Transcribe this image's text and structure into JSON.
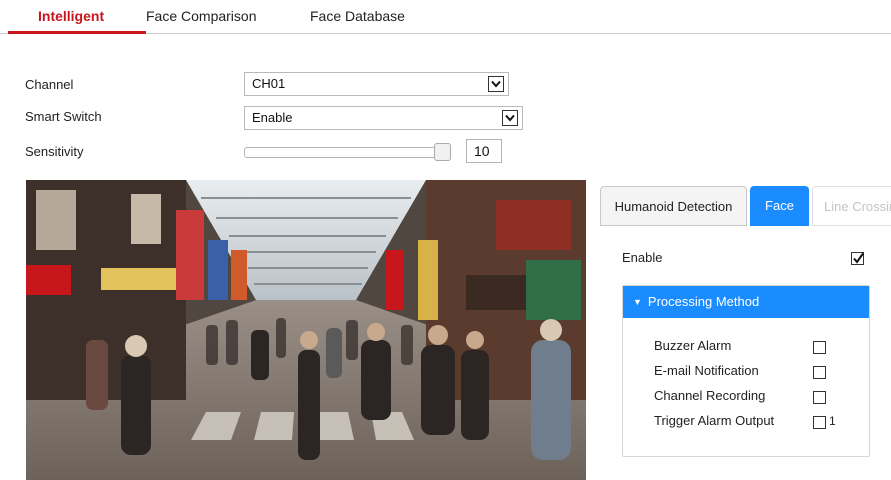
{
  "tabs": {
    "items": [
      "Intelligent",
      "Face Comparison",
      "Face Database"
    ],
    "active": "Intelligent",
    "accent_color": "#c8161d"
  },
  "form": {
    "channel": {
      "label": "Channel",
      "value": "CH01"
    },
    "smart_switch": {
      "label": "Smart Switch",
      "value": "Enable"
    },
    "sensitivity": {
      "label": "Sensitivity",
      "value": "10",
      "level_fraction": 0.92
    }
  },
  "detection_tabs": {
    "items": [
      "Humanoid Detection",
      "Face",
      "Line Crossing"
    ],
    "active": "Face",
    "active_color": "#1a8cff"
  },
  "face_panel": {
    "enable_label": "Enable",
    "enable_checked": true,
    "processing": {
      "title": "Processing Method",
      "items": [
        {
          "label": "Buzzer Alarm",
          "checked": false
        },
        {
          "label": "E-mail Notification",
          "checked": false
        },
        {
          "label": "Channel Recording",
          "checked": false
        },
        {
          "label": "Trigger Alarm Output",
          "checked": false,
          "suffix": "1"
        }
      ]
    }
  },
  "icons": {
    "select_arrow": "chevron-down-icon",
    "checkbox_check": "check-icon",
    "expand_triangle": "caret-down-icon"
  }
}
